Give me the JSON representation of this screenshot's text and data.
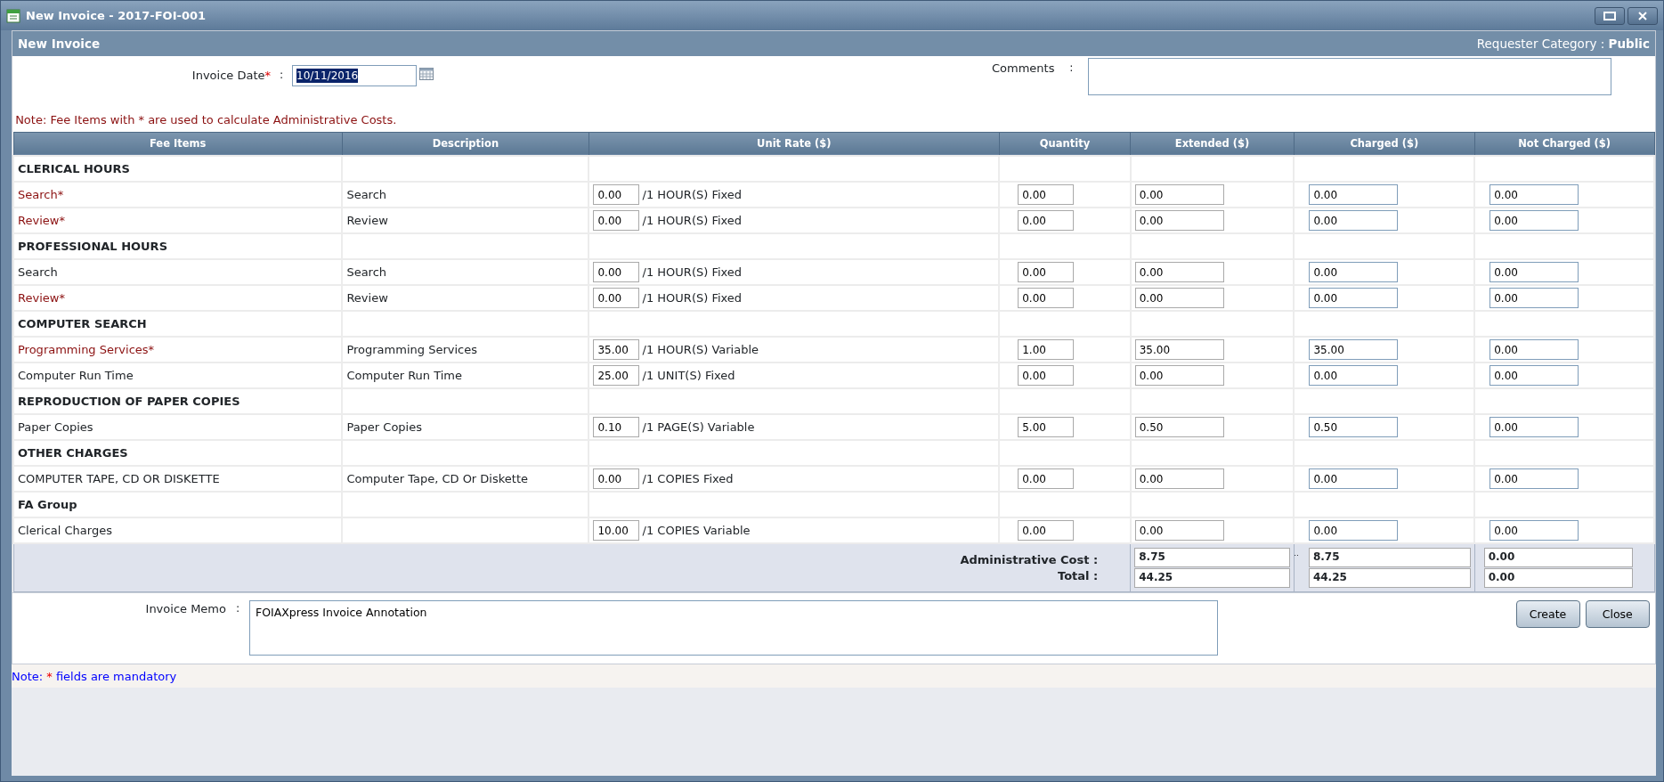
{
  "window": {
    "title": "New Invoice - 2017-FOI-001"
  },
  "panel": {
    "title": "New Invoice",
    "requester": "Requester Category : **Public**"
  },
  "invoice_date": {
    "label": "Invoice Date",
    "required_mark": "*",
    "separator": ":",
    "value": "10/11/2016"
  },
  "comments": {
    "label": "Comments",
    "separator": ":"
  },
  "note": "Note: Fee Items with * are used to calculate Administrative Costs.",
  "table": {
    "columns": [
      "Fee Items",
      "Description",
      "Unit Rate ($)",
      "Quantity",
      "Extended ($)",
      "Charged ($)",
      "Not Charged ($)"
    ],
    "rows": [
      {
        "kind": "group",
        "fee_item": "CLERICAL HOURS"
      },
      {
        "kind": "item",
        "fee_item": "Search*",
        "required": true,
        "description": "Search",
        "unit_rate": "0.00",
        "unit_label": "/1 HOUR(S) Fixed",
        "quantity": "0.00",
        "extended": "0.00",
        "charged": "0.00",
        "not_charged": "0.00"
      },
      {
        "kind": "item",
        "fee_item": "Review*",
        "required": true,
        "description": "Review",
        "unit_rate": "0.00",
        "unit_label": "/1 HOUR(S) Fixed",
        "quantity": "0.00",
        "extended": "0.00",
        "charged": "0.00",
        "not_charged": "0.00"
      },
      {
        "kind": "group",
        "fee_item": "PROFESSIONAL HOURS"
      },
      {
        "kind": "item",
        "fee_item": "Search",
        "required": false,
        "description": "Search",
        "unit_rate": "0.00",
        "unit_label": "/1 HOUR(S) Fixed",
        "quantity": "0.00",
        "extended": "0.00",
        "charged": "0.00",
        "not_charged": "0.00"
      },
      {
        "kind": "item",
        "fee_item": "Review*",
        "required": true,
        "description": "Review",
        "unit_rate": "0.00",
        "unit_label": "/1 HOUR(S) Fixed",
        "quantity": "0.00",
        "extended": "0.00",
        "charged": "0.00",
        "not_charged": "0.00"
      },
      {
        "kind": "group",
        "fee_item": "COMPUTER SEARCH"
      },
      {
        "kind": "item",
        "fee_item": "Programming Services*",
        "required": true,
        "description": "Programming Services",
        "unit_rate": "35.00",
        "unit_label": "/1 HOUR(S) Variable",
        "quantity": "1.00",
        "extended": "35.00",
        "charged": "35.00",
        "not_charged": "0.00"
      },
      {
        "kind": "item",
        "fee_item": "Computer Run Time",
        "required": false,
        "description": "Computer Run Time",
        "unit_rate": "25.00",
        "unit_label": "/1 UNIT(S) Fixed",
        "quantity": "0.00",
        "extended": "0.00",
        "charged": "0.00",
        "not_charged": "0.00"
      },
      {
        "kind": "group",
        "fee_item": "REPRODUCTION OF PAPER COPIES"
      },
      {
        "kind": "item",
        "fee_item": "Paper Copies",
        "required": false,
        "description": "Paper Copies",
        "unit_rate": "0.10",
        "unit_label": "/1 PAGE(S) Variable",
        "quantity": "5.00",
        "extended": "0.50",
        "charged": "0.50",
        "not_charged": "0.00"
      },
      {
        "kind": "group",
        "fee_item": "OTHER CHARGES"
      },
      {
        "kind": "item",
        "fee_item": "COMPUTER TAPE, CD OR DISKETTE",
        "required": false,
        "description": "Computer Tape, CD Or Diskette",
        "unit_rate": "0.00",
        "unit_label": "/1 COPIES Fixed",
        "quantity": "0.00",
        "extended": "0.00",
        "charged": "0.00",
        "not_charged": "0.00"
      },
      {
        "kind": "group",
        "fee_item": "FA Group"
      },
      {
        "kind": "item",
        "fee_item": "Clerical Charges",
        "required": false,
        "unit_rate": "10.00",
        "unit_label": "/1 COPIES Variable",
        "quantity": "0.00",
        "extended": "0.00",
        "charged": "0.00",
        "not_charged": "0.00"
      }
    ]
  },
  "totals": {
    "admin_label": "Administrative Cost :",
    "total_label": "Total :",
    "admin_extended": "8.75",
    "admin_mark": "..",
    "admin_charged": "8.75",
    "admin_not_charged": "0.00",
    "total_extended": "44.25",
    "total_charged": "44.25",
    "total_not_charged": "0.00"
  },
  "memo": {
    "label": "Invoice Memo",
    "separator": ":",
    "value": "FOIAXpress Invoice Annotation"
  },
  "buttons": [
    "Create",
    "Close"
  ],
  "footer_note": {
    "prefix": "Note:",
    "mark": "*",
    "suffix": "fields are mandatory"
  }
}
